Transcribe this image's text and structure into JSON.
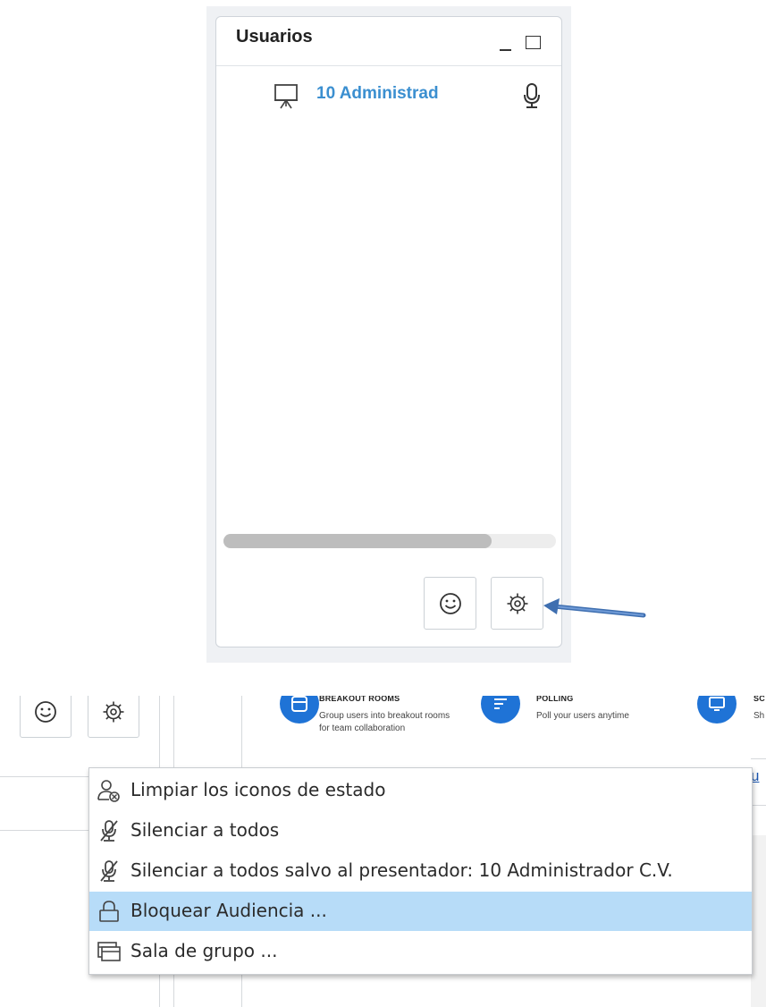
{
  "users_panel": {
    "title": "Usuarios",
    "users": [
      {
        "name": "10 Administrad"
      }
    ]
  },
  "settings_menu": {
    "items": [
      {
        "label": "Limpiar los iconos de estado",
        "icon": "clear-status-icon"
      },
      {
        "label": "Silenciar a todos",
        "icon": "mute-mic-icon"
      },
      {
        "label": "Silenciar a todos salvo al presentador: 10 Administrador C.V.",
        "icon": "mute-mic-icon"
      },
      {
        "label": "Bloquear Audiencia ...",
        "icon": "lock-icon",
        "highlighted": true
      },
      {
        "label": "Sala de grupo ...",
        "icon": "breakout-room-icon"
      }
    ]
  },
  "background_features": [
    {
      "title": "BREAKOUT ROOMS",
      "description": "Group users into breakout rooms for team collaboration"
    },
    {
      "title": "POLLING",
      "description": "Poll your users anytime"
    },
    {
      "title": "SC",
      "description": "Sh"
    }
  ],
  "edge_link": "u",
  "colors": {
    "accent_blue": "#3b8fd0",
    "feature_circle": "#1f73d6",
    "menu_highlight": "#b7dcf8",
    "callout_arrow": "#3f6fb0"
  }
}
